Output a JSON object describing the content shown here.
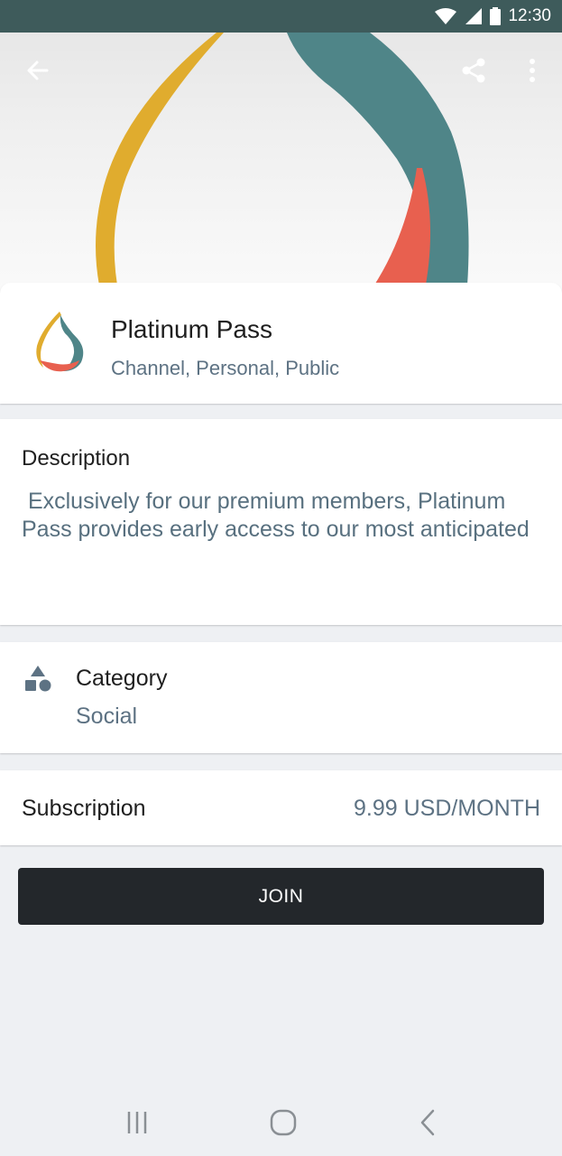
{
  "status_bar": {
    "time": "12:30",
    "icons": [
      "wifi-icon",
      "cellular-signal-icon",
      "battery-icon"
    ]
  },
  "header": {
    "back_icon": "arrow-left-icon",
    "share_icon": "share-icon",
    "menu_icon": "more-vert-icon"
  },
  "profile": {
    "title": "Platinum Pass",
    "subtitle": "Channel, Personal, Public"
  },
  "description": {
    "heading": "Description",
    "text": " Exclusively for our premium members, Platinum Pass provides early access to our most anticipated"
  },
  "category": {
    "icon": "category-shapes-icon",
    "heading": "Category",
    "value": "Social"
  },
  "subscription": {
    "label": "Subscription",
    "price": "9.99 USD/MONTH"
  },
  "actions": {
    "join_label": "JOIN"
  },
  "nav_bar": {
    "icons": [
      "recent-apps-icon",
      "home-icon",
      "back-icon"
    ]
  },
  "colors": {
    "status_bar": "#3e5b5b",
    "join_button": "#23272b",
    "muted_text": "#5d7283",
    "logo_yellow": "#e0ac2e",
    "logo_teal": "#4f8588",
    "logo_red": "#e8604f"
  }
}
